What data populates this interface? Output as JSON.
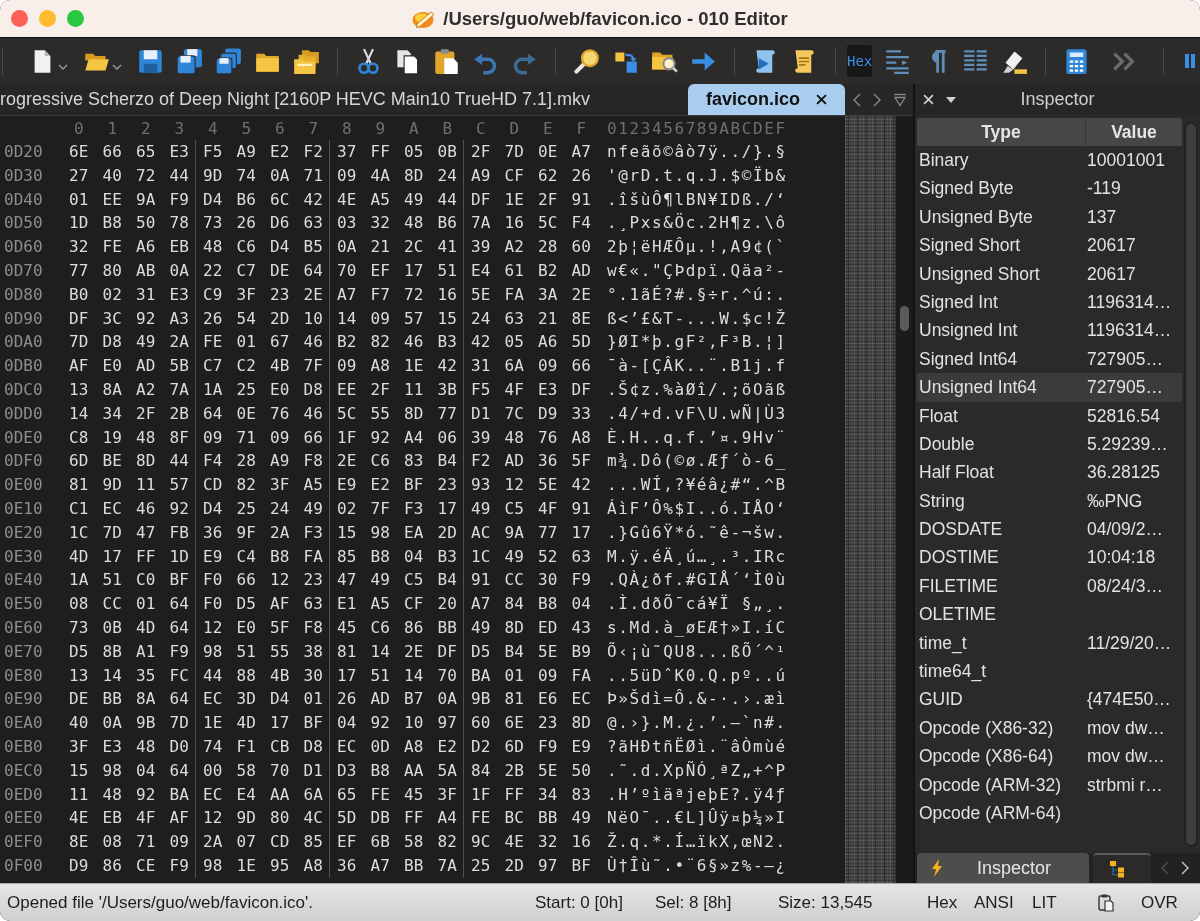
{
  "window": {
    "title": "/Users/guo/web/favicon.ico - 010 Editor"
  },
  "toolbar": {
    "hex_toggle": {
      "label": "Hex",
      "selected": true
    }
  },
  "tabs": [
    {
      "label": "rogressive Scherzo of Deep Night [2160P HEVC Main10 TrueHD 7.1].mkv",
      "selected": false
    },
    {
      "label": "favicon.ico",
      "selected": true
    }
  ],
  "hex_view": {
    "column_headers": [
      "0",
      "1",
      "2",
      "3",
      "4",
      "5",
      "6",
      "7",
      "8",
      "9",
      "A",
      "B",
      "C",
      "D",
      "E",
      "F"
    ],
    "ascii_header": "0123456789ABCDEF",
    "rows": [
      {
        "offset": "0D20",
        "bytes": [
          "6E",
          "66",
          "65",
          "E3",
          "F5",
          "A9",
          "E2",
          "F2",
          "37",
          "FF",
          "05",
          "0B",
          "2F",
          "7D",
          "0E",
          "A7"
        ],
        "ascii": "nfeãõ©âò7ÿ../}.§"
      },
      {
        "offset": "0D30",
        "bytes": [
          "27",
          "40",
          "72",
          "44",
          "9D",
          "74",
          "0A",
          "71",
          "09",
          "4A",
          "8D",
          "24",
          "A9",
          "CF",
          "62",
          "26"
        ],
        "ascii": "'@rD.t.q.J.$©Ïb&"
      },
      {
        "offset": "0D40",
        "bytes": [
          "01",
          "EE",
          "9A",
          "F9",
          "D4",
          "B6",
          "6C",
          "42",
          "4E",
          "A5",
          "49",
          "44",
          "DF",
          "1E",
          "2F",
          "91"
        ],
        "ascii": ".îšùÔ¶lBN¥IDß./‘"
      },
      {
        "offset": "0D50",
        "bytes": [
          "1D",
          "B8",
          "50",
          "78",
          "73",
          "26",
          "D6",
          "63",
          "03",
          "32",
          "48",
          "B6",
          "7A",
          "16",
          "5C",
          "F4"
        ],
        "ascii": ".¸Pxs&Öc.2H¶z.\\ô"
      },
      {
        "offset": "0D60",
        "bytes": [
          "32",
          "FE",
          "A6",
          "EB",
          "48",
          "C6",
          "D4",
          "B5",
          "0A",
          "21",
          "2C",
          "41",
          "39",
          "A2",
          "28",
          "60"
        ],
        "ascii": "2þ¦ëHÆÔµ.!,A9¢(`"
      },
      {
        "offset": "0D70",
        "bytes": [
          "77",
          "80",
          "AB",
          "0A",
          "22",
          "C7",
          "DE",
          "64",
          "70",
          "EF",
          "17",
          "51",
          "E4",
          "61",
          "B2",
          "AD"
        ],
        "ascii": "w€«.\"ÇÞdpï.Qäa²-"
      },
      {
        "offset": "0D80",
        "bytes": [
          "B0",
          "02",
          "31",
          "E3",
          "C9",
          "3F",
          "23",
          "2E",
          "A7",
          "F7",
          "72",
          "16",
          "5E",
          "FA",
          "3A",
          "2E"
        ],
        "ascii": "°.1ãÉ?#.§÷r.^ú:."
      },
      {
        "offset": "0D90",
        "bytes": [
          "DF",
          "3C",
          "92",
          "A3",
          "26",
          "54",
          "2D",
          "10",
          "14",
          "09",
          "57",
          "15",
          "24",
          "63",
          "21",
          "8E"
        ],
        "ascii": "ß<’£&T-...W.$c!Ž"
      },
      {
        "offset": "0DA0",
        "bytes": [
          "7D",
          "D8",
          "49",
          "2A",
          "FE",
          "01",
          "67",
          "46",
          "B2",
          "82",
          "46",
          "B3",
          "42",
          "05",
          "A6",
          "5D"
        ],
        "ascii": "}ØI*þ.gF²‚F³B.¦]"
      },
      {
        "offset": "0DB0",
        "bytes": [
          "AF",
          "E0",
          "AD",
          "5B",
          "C7",
          "C2",
          "4B",
          "7F",
          "09",
          "A8",
          "1E",
          "42",
          "31",
          "6A",
          "09",
          "66"
        ],
        "ascii": "¯à-[ÇÂK..¨.B1j.f"
      },
      {
        "offset": "0DC0",
        "bytes": [
          "13",
          "8A",
          "A2",
          "7A",
          "1A",
          "25",
          "E0",
          "D8",
          "EE",
          "2F",
          "11",
          "3B",
          "F5",
          "4F",
          "E3",
          "DF"
        ],
        "ascii": ".Š¢z.%àØî/.;õOãß"
      },
      {
        "offset": "0DD0",
        "bytes": [
          "14",
          "34",
          "2F",
          "2B",
          "64",
          "0E",
          "76",
          "46",
          "5C",
          "55",
          "8D",
          "77",
          "D1",
          "7C",
          "D9",
          "33"
        ],
        "ascii": ".4/+d.vF\\U.wÑ|Ù3"
      },
      {
        "offset": "0DE0",
        "bytes": [
          "C8",
          "19",
          "48",
          "8F",
          "09",
          "71",
          "09",
          "66",
          "1F",
          "92",
          "A4",
          "06",
          "39",
          "48",
          "76",
          "A8"
        ],
        "ascii": "È.H..q.f.’¤.9Hv¨"
      },
      {
        "offset": "0DF0",
        "bytes": [
          "6D",
          "BE",
          "8D",
          "44",
          "F4",
          "28",
          "A9",
          "F8",
          "2E",
          "C6",
          "83",
          "B4",
          "F2",
          "AD",
          "36",
          "5F"
        ],
        "ascii": "m¾.Dô(©ø.Æƒ´ò-6_"
      },
      {
        "offset": "0E00",
        "bytes": [
          "81",
          "9D",
          "11",
          "57",
          "CD",
          "82",
          "3F",
          "A5",
          "E9",
          "E2",
          "BF",
          "23",
          "93",
          "12",
          "5E",
          "42"
        ],
        "ascii": "...WÍ‚?¥éâ¿#“.^B"
      },
      {
        "offset": "0E10",
        "bytes": [
          "C1",
          "EC",
          "46",
          "92",
          "D4",
          "25",
          "24",
          "49",
          "02",
          "7F",
          "F3",
          "17",
          "49",
          "C5",
          "4F",
          "91"
        ],
        "ascii": "ÁìF’Ô%$I..ó.IÅO‘"
      },
      {
        "offset": "0E20",
        "bytes": [
          "1C",
          "7D",
          "47",
          "FB",
          "36",
          "9F",
          "2A",
          "F3",
          "15",
          "98",
          "EA",
          "2D",
          "AC",
          "9A",
          "77",
          "17"
        ],
        "ascii": ".}Gû6Ÿ*ó.˜ê-¬šw."
      },
      {
        "offset": "0E30",
        "bytes": [
          "4D",
          "17",
          "FF",
          "1D",
          "E9",
          "C4",
          "B8",
          "FA",
          "85",
          "B8",
          "04",
          "B3",
          "1C",
          "49",
          "52",
          "63"
        ],
        "ascii": "M.ÿ.éÄ¸ú…¸.³.IRc"
      },
      {
        "offset": "0E40",
        "bytes": [
          "1A",
          "51",
          "C0",
          "BF",
          "F0",
          "66",
          "12",
          "23",
          "47",
          "49",
          "C5",
          "B4",
          "91",
          "CC",
          "30",
          "F9"
        ],
        "ascii": ".QÀ¿ðf.#GIÅ´‘Ì0ù"
      },
      {
        "offset": "0E50",
        "bytes": [
          "08",
          "CC",
          "01",
          "64",
          "F0",
          "D5",
          "AF",
          "63",
          "E1",
          "A5",
          "CF",
          "20",
          "A7",
          "84",
          "B8",
          "04"
        ],
        "ascii": ".Ì.dðÕ¯cá¥Ï §„¸."
      },
      {
        "offset": "0E60",
        "bytes": [
          "73",
          "0B",
          "4D",
          "64",
          "12",
          "E0",
          "5F",
          "F8",
          "45",
          "C6",
          "86",
          "BB",
          "49",
          "8D",
          "ED",
          "43"
        ],
        "ascii": "s.Md.à_øEÆ†»I.íC"
      },
      {
        "offset": "0E70",
        "bytes": [
          "D5",
          "8B",
          "A1",
          "F9",
          "98",
          "51",
          "55",
          "38",
          "81",
          "14",
          "2E",
          "DF",
          "D5",
          "B4",
          "5E",
          "B9"
        ],
        "ascii": "Õ‹¡ù˜QU8...ßÕ´^¹"
      },
      {
        "offset": "0E80",
        "bytes": [
          "13",
          "14",
          "35",
          "FC",
          "44",
          "88",
          "4B",
          "30",
          "17",
          "51",
          "14",
          "70",
          "BA",
          "01",
          "09",
          "FA"
        ],
        "ascii": "..5üDˆK0.Q.pº..ú"
      },
      {
        "offset": "0E90",
        "bytes": [
          "DE",
          "BB",
          "8A",
          "64",
          "EC",
          "3D",
          "D4",
          "01",
          "26",
          "AD",
          "B7",
          "0A",
          "9B",
          "81",
          "E6",
          "EC"
        ],
        "ascii": "Þ»Šdì=Ô.&-·.›.æì"
      },
      {
        "offset": "0EA0",
        "bytes": [
          "40",
          "0A",
          "9B",
          "7D",
          "1E",
          "4D",
          "17",
          "BF",
          "04",
          "92",
          "10",
          "97",
          "60",
          "6E",
          "23",
          "8D"
        ],
        "ascii": "@.›}.M.¿.’.—`n#."
      },
      {
        "offset": "0EB0",
        "bytes": [
          "3F",
          "E3",
          "48",
          "D0",
          "74",
          "F1",
          "CB",
          "D8",
          "EC",
          "0D",
          "A8",
          "E2",
          "D2",
          "6D",
          "F9",
          "E9"
        ],
        "ascii": "?ãHÐtñËØì.¨âÒmùé"
      },
      {
        "offset": "0EC0",
        "bytes": [
          "15",
          "98",
          "04",
          "64",
          "00",
          "58",
          "70",
          "D1",
          "D3",
          "B8",
          "AA",
          "5A",
          "84",
          "2B",
          "5E",
          "50"
        ],
        "ascii": ".˜.d.XpÑÓ¸ªZ„+^P"
      },
      {
        "offset": "0ED0",
        "bytes": [
          "11",
          "48",
          "92",
          "BA",
          "EC",
          "E4",
          "AA",
          "6A",
          "65",
          "FE",
          "45",
          "3F",
          "1F",
          "FF",
          "34",
          "83"
        ],
        "ascii": ".H’ºìäªjeþE?.ÿ4ƒ"
      },
      {
        "offset": "0EE0",
        "bytes": [
          "4E",
          "EB",
          "4F",
          "AF",
          "12",
          "9D",
          "80",
          "4C",
          "5D",
          "DB",
          "FF",
          "A4",
          "FE",
          "BC",
          "BB",
          "49"
        ],
        "ascii": "NëO¯..€L]Ûÿ¤þ¼»I"
      },
      {
        "offset": "0EF0",
        "bytes": [
          "8E",
          "08",
          "71",
          "09",
          "2A",
          "07",
          "CD",
          "85",
          "EF",
          "6B",
          "58",
          "82",
          "9C",
          "4E",
          "32",
          "16"
        ],
        "ascii": "Ž.q.*.Í…ïkX‚œN2."
      },
      {
        "offset": "0F00",
        "bytes": [
          "D9",
          "86",
          "CE",
          "F9",
          "98",
          "1E",
          "95",
          "A8",
          "36",
          "A7",
          "BB",
          "7A",
          "25",
          "2D",
          "97",
          "BF"
        ],
        "ascii": "Ù†Îù˜.•¨6§»z%-—¿"
      }
    ]
  },
  "inspector": {
    "title": "Inspector",
    "columns": [
      "Type",
      "Value"
    ],
    "rows": [
      {
        "type": "Binary",
        "value": "10001001",
        "selected": false
      },
      {
        "type": "Signed Byte",
        "value": "-119",
        "selected": false
      },
      {
        "type": "Unsigned Byte",
        "value": "137",
        "selected": false
      },
      {
        "type": "Signed Short",
        "value": "20617",
        "selected": false
      },
      {
        "type": "Unsigned Short",
        "value": "20617",
        "selected": false
      },
      {
        "type": "Signed Int",
        "value": "1196314…",
        "selected": false
      },
      {
        "type": "Unsigned Int",
        "value": "1196314…",
        "selected": false
      },
      {
        "type": "Signed Int64",
        "value": "727905…",
        "selected": false
      },
      {
        "type": "Unsigned Int64",
        "value": "727905…",
        "selected": true
      },
      {
        "type": "Float",
        "value": "52816.54",
        "selected": false
      },
      {
        "type": "Double",
        "value": "5.29239…",
        "selected": false
      },
      {
        "type": "Half Float",
        "value": "36.28125",
        "selected": false
      },
      {
        "type": "String",
        "value": "‰PNG",
        "selected": false
      },
      {
        "type": "DOSDATE",
        "value": "04/09/2…",
        "selected": false
      },
      {
        "type": "DOSTIME",
        "value": "10:04:18",
        "selected": false
      },
      {
        "type": "FILETIME",
        "value": "08/24/3…",
        "selected": false
      },
      {
        "type": "OLETIME",
        "selected": false
      },
      {
        "type": "time_t",
        "value": "11/29/20…",
        "selected": false
      },
      {
        "type": "time64_t",
        "selected": false
      },
      {
        "type": "GUID",
        "value": "{474E50…",
        "selected": false
      },
      {
        "type": "Opcode (X86-32)",
        "value": "mov dw…",
        "selected": false
      },
      {
        "type": "Opcode (X86-64)",
        "value": "mov dw…",
        "selected": false
      },
      {
        "type": "Opcode (ARM-32)",
        "value": "strbmi r…",
        "selected": false
      },
      {
        "type": "Opcode (ARM-64)",
        "selected": false
      }
    ],
    "tabs": [
      {
        "label": "Inspector",
        "selected": true
      },
      {
        "selected": false
      }
    ]
  },
  "status_bar": {
    "message": "Opened file '/Users/guo/web/favicon.ico'.",
    "start": "Start: 0 [0h]",
    "selection": "Sel: 8 [8h]",
    "size": "Size: 13,545",
    "mode": "Hex",
    "charset": "ANSI",
    "byte_order": "LIT",
    "insert_mode": "OVR"
  }
}
